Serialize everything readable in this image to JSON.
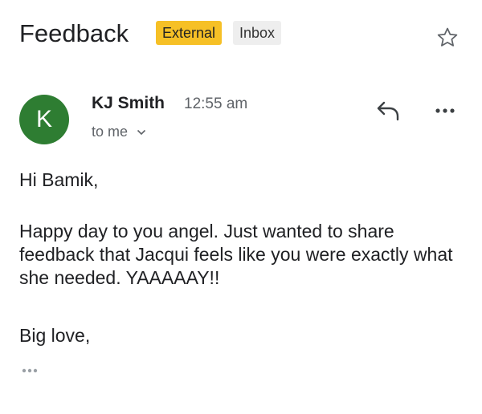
{
  "email": {
    "subject": "Feedback",
    "labels": [
      "External",
      "Inbox"
    ],
    "sender": {
      "avatar_letter": "K",
      "avatar_color": "#2e7d32",
      "name": "KJ Smith",
      "time": "12:55 am",
      "recipients": "to me"
    },
    "body": {
      "greeting": "Hi Bamik,",
      "paragraph": "Happy day to you angel. Just wanted to share feedback that Jacqui feels like you were exactly what she needed. YAAAAAY!!",
      "signoff": "Big love,"
    }
  },
  "icons": {
    "star": "star-outline-icon",
    "reply": "reply-arrow-icon",
    "more": "more-horizontal-icon",
    "expand": "chevron-down-icon",
    "trimmed": "trimmed-content-icon"
  },
  "colors": {
    "external_label": "#f6c026",
    "inbox_label": "#eeeeee"
  }
}
